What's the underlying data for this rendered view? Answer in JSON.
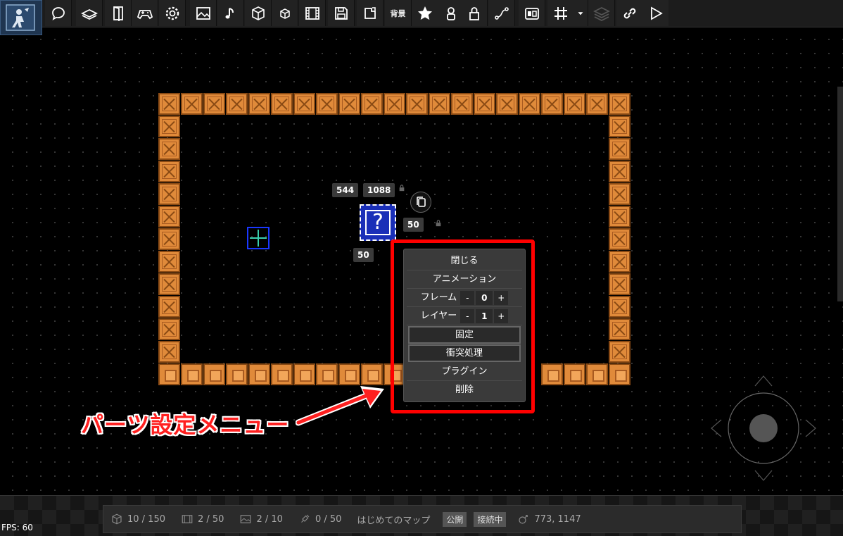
{
  "toolbar": {
    "items": [
      "logo-icon",
      "speech-bubble-icon",
      "layers-book-icon",
      "door-icon",
      "gamepad-icon",
      "gear-icon",
      "image-icon",
      "music-note-icon",
      "cube-icon",
      "small-cube-icon",
      "film-icon",
      "save-icon",
      "export-icon",
      "背景",
      "star-icon",
      "person-icon",
      "lock-icon",
      "path-node-icon",
      "switch-icon",
      "grid-icon",
      "dropdown-arrow-icon",
      "layers-icon",
      "link-icon",
      "play-icon"
    ],
    "background_label": "背景"
  },
  "selection": {
    "x": "544",
    "y": "1088",
    "width": "50",
    "height": "50"
  },
  "menu": {
    "close": "閉じる",
    "animation": "アニメーション",
    "frame_label": "フレーム",
    "frame_value": "0",
    "layer_label": "レイヤー",
    "layer_value": "1",
    "minus": "-",
    "plus": "+",
    "fixed": "固定",
    "collision": "衝突処理",
    "plugin": "プラグイン",
    "delete": "削除"
  },
  "annotation": {
    "text": "パーツ設定メニュー",
    "color": "#ff2020"
  },
  "status": {
    "blocks": "10 / 150",
    "frames": "2 / 50",
    "images": "2 / 10",
    "sounds": "0 / 50",
    "map_name": "はじめてのマップ",
    "public_badge": "公開",
    "connection_badge": "接続中",
    "coords": "773, 1147"
  },
  "fps": "FPS: 60",
  "colors": {
    "crate": "#e08a3a",
    "question_block": "#1a2fb8",
    "highlight": "#ff0000"
  }
}
